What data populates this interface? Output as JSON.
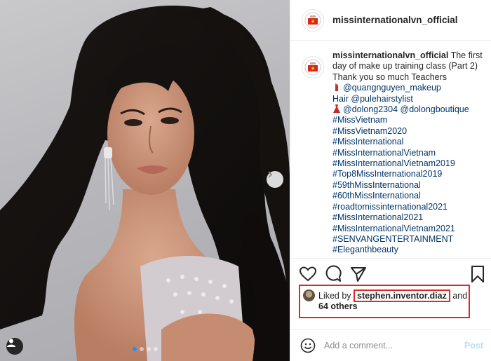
{
  "post": {
    "username": "missinternationalvn_official",
    "carousel": {
      "slides": 4,
      "active": 1
    }
  },
  "caption": {
    "username": "missinternationalvn_official",
    "lines": [
      "The first",
      "day of make up training class (Part 2)",
      "Thank you so much Teachers",
      "@quangnguyen_makeup",
      "Hair @pulehairstylist",
      "@dolong2304 @dolongboutique",
      "#MissVietnam",
      "#MissVietnam2020",
      "#MissInternational",
      "#MissInternationalVietnam",
      "#MissInternationalVietnam2019",
      "#Top8MissInternational2019",
      "#59thMissInternational",
      "#60thMissInternational",
      "#roadtomissinternational2021",
      "#MissInternational2021",
      "#MissInternationalVietnam2021",
      "#SENVANGENTERTAINMENT",
      "#Eleganthbeauty"
    ]
  },
  "likes": {
    "prefix": "Liked by",
    "user": "stephen.inventor.diaz",
    "and": "and",
    "others": "64 others"
  },
  "comment": {
    "placeholder": "Add a comment...",
    "post_label": "Post"
  },
  "colors": {
    "link": "#003569",
    "highlight": "#e3262a",
    "post_disabled": "#b2dffc"
  }
}
